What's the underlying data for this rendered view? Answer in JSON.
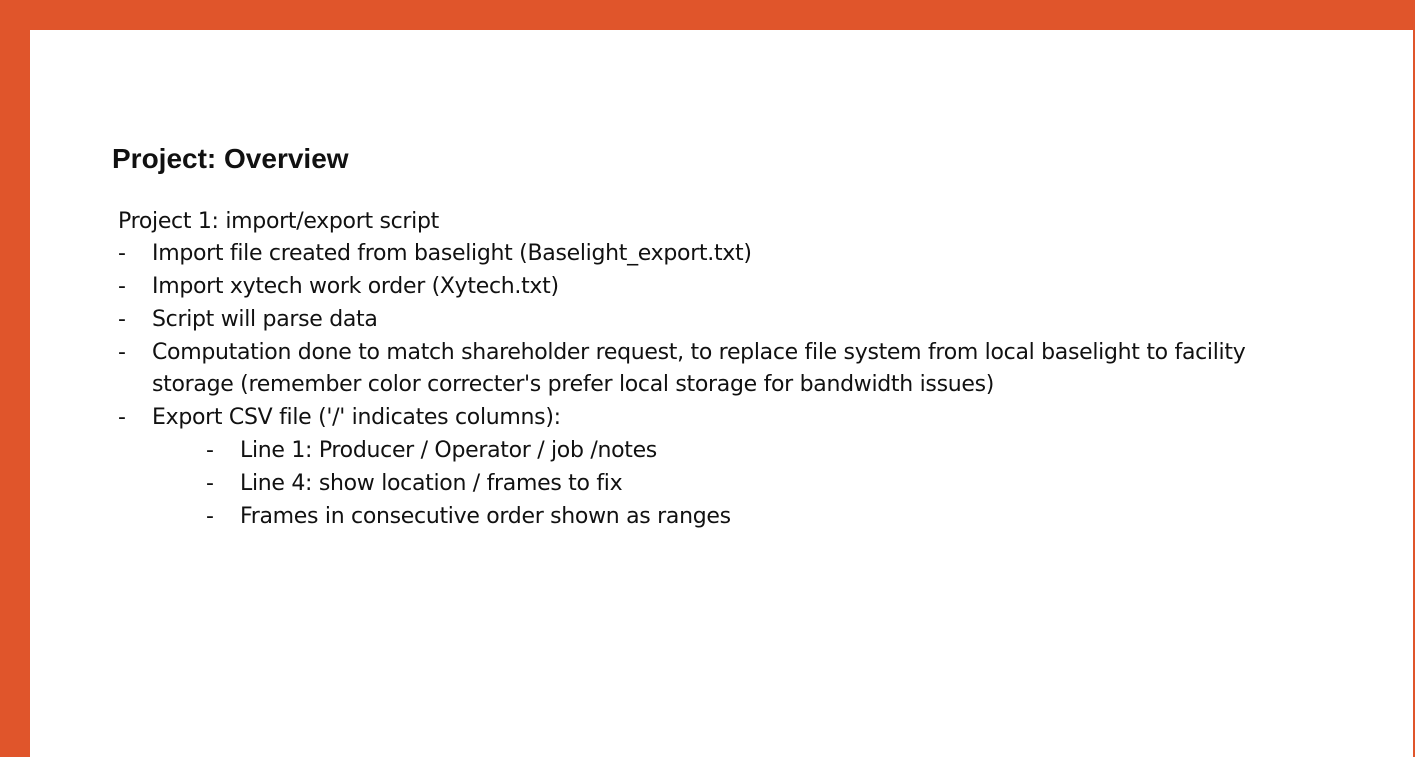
{
  "colors": {
    "frame": "#e0552b",
    "background": "#ffffff",
    "text": "#111111"
  },
  "slide": {
    "title": "Project: Overview",
    "intro": "Project 1: import/export script",
    "bullet_marker": "-",
    "items": [
      {
        "text": "Import file created from baselight (Baselight_export.txt)"
      },
      {
        "text": "Import xytech work order (Xytech.txt)"
      },
      {
        "text": "Script will parse data"
      },
      {
        "text": "Computation done to match shareholder request, to replace file system from local baselight to facility storage (remember color correcter's prefer local storage for bandwidth issues)"
      },
      {
        "text": "Export CSV file ('/' indicates columns):"
      }
    ],
    "subitems": [
      {
        "text": "Line 1: Producer / Operator / job /notes"
      },
      {
        "text": "Line 4:  show location / frames to fix"
      },
      {
        "text": "Frames in consecutive order shown as ranges"
      }
    ]
  }
}
